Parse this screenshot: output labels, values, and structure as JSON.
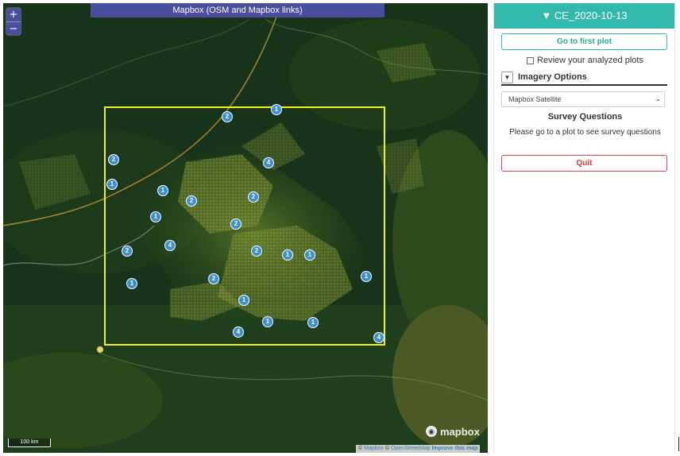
{
  "map": {
    "layer_banner": "Mapbox (OSM and Mapbox links)",
    "zoom_in_label": "+",
    "zoom_out_label": "−",
    "scale_label": "100 km",
    "logo_text": "mapbox",
    "attribution": {
      "mapbox": "Mapbox",
      "osm": "OpenStreetMap",
      "improve": "Improve this map"
    },
    "box_color": "#f2f01a",
    "cluster_color": "#3d8fd4",
    "clusters": [
      {
        "count": "1"
      },
      {
        "count": "2"
      },
      {
        "count": "2"
      },
      {
        "count": "4"
      },
      {
        "count": "1"
      },
      {
        "count": "1"
      },
      {
        "count": "2"
      },
      {
        "count": "2"
      },
      {
        "count": "1"
      },
      {
        "count": "2"
      },
      {
        "count": "4"
      },
      {
        "count": "2"
      },
      {
        "count": "2"
      },
      {
        "count": "1"
      },
      {
        "count": "1"
      },
      {
        "count": "1"
      },
      {
        "count": "2"
      },
      {
        "count": "1"
      },
      {
        "count": "1"
      },
      {
        "count": "1"
      },
      {
        "count": "1"
      },
      {
        "count": "4"
      }
    ]
  },
  "sidebar": {
    "project_title": "▼ CE_2020-10-13",
    "accent_color": "#31b9ad",
    "go_first_label": "Go to first plot",
    "review_label": "Review your analyzed plots",
    "imagery_toggle": "▼",
    "imagery_label": "Imagery Options",
    "imagery_selected": "Mapbox Satellite",
    "survey_title": "Survey Questions",
    "survey_message": "Please go to a plot to see survey questions",
    "quit_label": "Quit",
    "quit_color": "#e0414e"
  }
}
